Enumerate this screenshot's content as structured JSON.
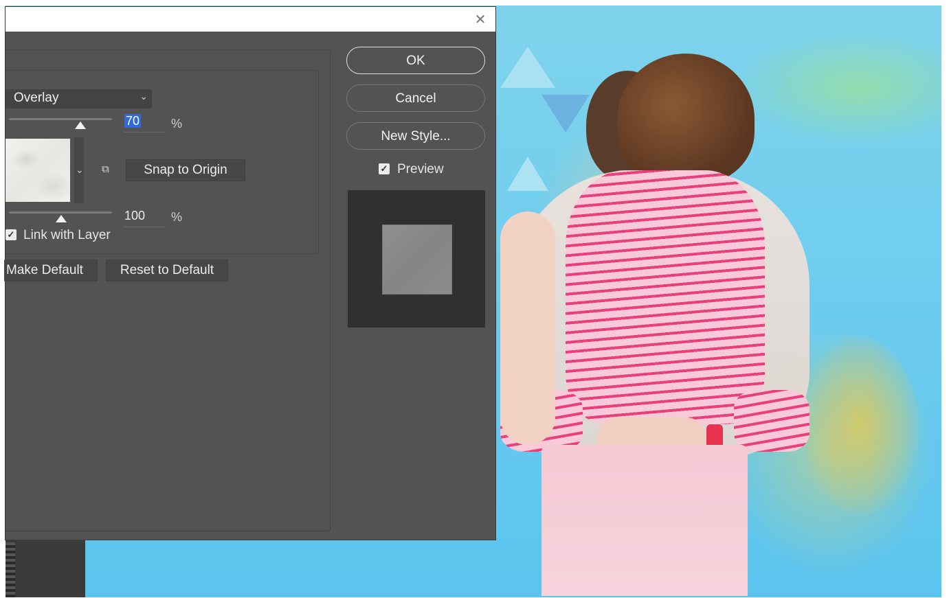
{
  "dialog": {
    "close_icon": "close-icon",
    "blend_mode": "Overlay",
    "opacity_value": "70",
    "opacity_percent": 70,
    "opacity_unit": "%",
    "scale_value": "100",
    "scale_percent": 100,
    "scale_unit": "%",
    "snap_label": "Snap to Origin",
    "link_label": "Link with Layer",
    "link_checked": true,
    "make_default_label": "Make Default",
    "reset_default_label": "Reset to Default"
  },
  "actions": {
    "ok_label": "OK",
    "cancel_label": "Cancel",
    "new_style_label": "New Style...",
    "preview_label": "Preview",
    "preview_checked": true
  },
  "colors": {
    "dialog_bg": "#535353",
    "accent_selection": "#2f6ad8"
  }
}
